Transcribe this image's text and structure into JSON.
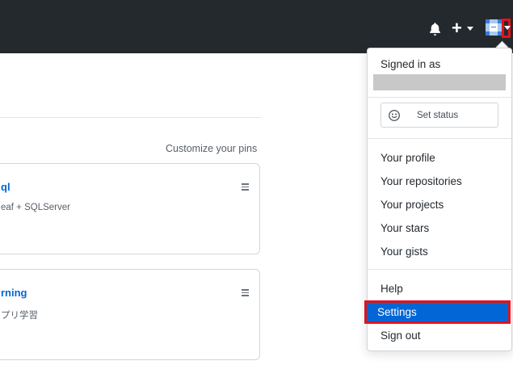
{
  "header": {
    "notifications_icon": "bell-icon",
    "create_icon": "plus-icon",
    "avatar_icon": "avatar-icon"
  },
  "main": {
    "customize_pins": "Customize your pins",
    "pins": [
      {
        "title": "ql",
        "description": "eaf + SQLServer"
      },
      {
        "title": "rning",
        "description": "プリ学習"
      }
    ]
  },
  "dropdown": {
    "signed_in_as": "Signed in as",
    "set_status": "Set status",
    "items": [
      {
        "label": "Your profile"
      },
      {
        "label": "Your repositories"
      },
      {
        "label": "Your projects"
      },
      {
        "label": "Your stars"
      },
      {
        "label": "Your gists"
      },
      {
        "label": "Help"
      },
      {
        "label": "Settings"
      },
      {
        "label": "Sign out"
      }
    ],
    "active_item": "Settings"
  },
  "colors": {
    "header_bg": "#24292e",
    "link": "#0366d6",
    "highlight": "#e0131c"
  }
}
